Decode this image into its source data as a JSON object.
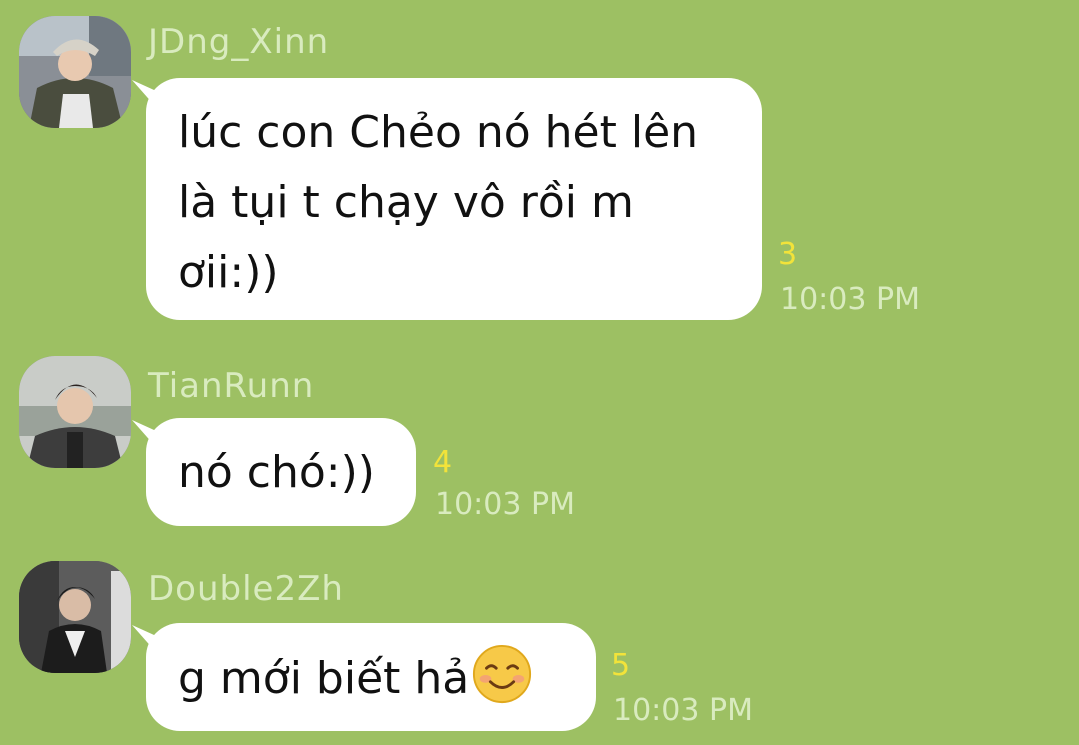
{
  "messages": [
    {
      "sender": "JDng_Xinn",
      "lines": [
        "lúc con Chẻo nó hét lên",
        "là tụi t chạy vô rồi m",
        "ơii:))"
      ],
      "read_count": "3",
      "time": "10:03 PM",
      "avatar_icon": "avatar-photo-icon"
    },
    {
      "sender": "TianRunn",
      "lines": [
        "nó chó:))"
      ],
      "read_count": "4",
      "time": "10:03 PM",
      "avatar_icon": "avatar-photo-icon"
    },
    {
      "sender": "Double2Zh",
      "lines": [
        "g mới biết hả"
      ],
      "emoji": "smiling-face-icon",
      "read_count": "5",
      "time": "10:03 PM",
      "avatar_icon": "avatar-photo-icon"
    }
  ],
  "colors": {
    "background": "#9dc063",
    "bubble": "#ffffff",
    "meta_text": "#d9ebbf",
    "read_count": "#f2e33a"
  }
}
